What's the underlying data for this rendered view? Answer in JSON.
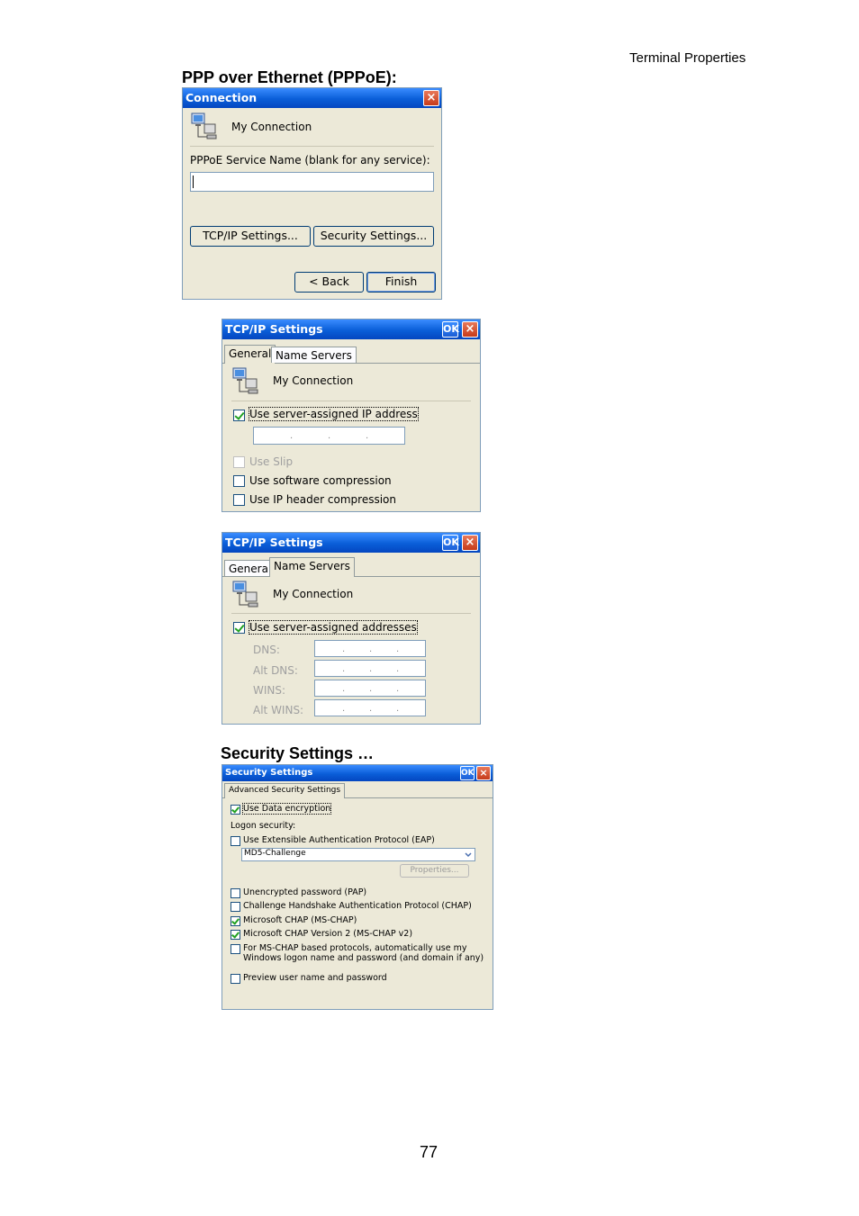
{
  "page": {
    "header": "Terminal Properties",
    "section_pppoe": "PPP over Ethernet (PPPoE):",
    "section_security": "Security Settings …",
    "page_number": "77"
  },
  "connection_dialog": {
    "title": "Connection",
    "close": "×",
    "connection_name": "My Connection",
    "service_label": "PPPoE Service Name (blank for any service):",
    "service_value": "",
    "tcpip_button": "TCP/IP Settings...",
    "security_button": "Security Settings...",
    "back_button": "< Back",
    "finish_button": "Finish"
  },
  "tcpip_general": {
    "title": "TCP/IP Settings",
    "ok": "OK",
    "close": "×",
    "tab_general": "General",
    "tab_name_servers": "Name Servers",
    "connection_name": "My Connection",
    "use_server_ip": "Use server-assigned IP address",
    "use_server_ip_checked": true,
    "use_slip": "Use Slip",
    "use_software_compression": "Use software compression",
    "use_ip_header_compression": "Use IP header compression"
  },
  "tcpip_nameservers": {
    "title": "TCP/IP Settings",
    "ok": "OK",
    "close": "×",
    "tab_general": "General",
    "tab_name_servers": "Name Servers",
    "connection_name": "My Connection",
    "use_server_addresses": "Use server-assigned addresses",
    "use_server_addresses_checked": true,
    "dns_label": "DNS:",
    "alt_dns_label": "Alt DNS:",
    "wins_label": "WINS:",
    "alt_wins_label": "Alt WINS:"
  },
  "security_settings": {
    "title": "Security Settings",
    "ok": "OK",
    "close": "×",
    "tab": "Advanced Security Settings",
    "use_data_encryption": "Use Data encryption",
    "logon_security": "Logon security:",
    "use_eap": "Use Extensible Authentication Protocol (EAP)",
    "eap_selected": "MD5-Challenge",
    "properties_button": "Properties...",
    "pap": "Unencrypted password (PAP)",
    "chap": "Challenge Handshake Authentication Protocol (CHAP)",
    "ms_chap": "Microsoft CHAP (MS-CHAP)",
    "ms_chap_v2": "Microsoft CHAP Version 2 (MS-CHAP v2)",
    "auto_logon_line1": "For MS-CHAP based protocols, automatically use my",
    "auto_logon_line2": "Windows logon name and password (and domain if any)",
    "preview": "Preview user name and password"
  },
  "colors": {
    "titlebar": "#0a5ed8",
    "dialog_bg": "#ece9d8",
    "check": "#21a121"
  }
}
